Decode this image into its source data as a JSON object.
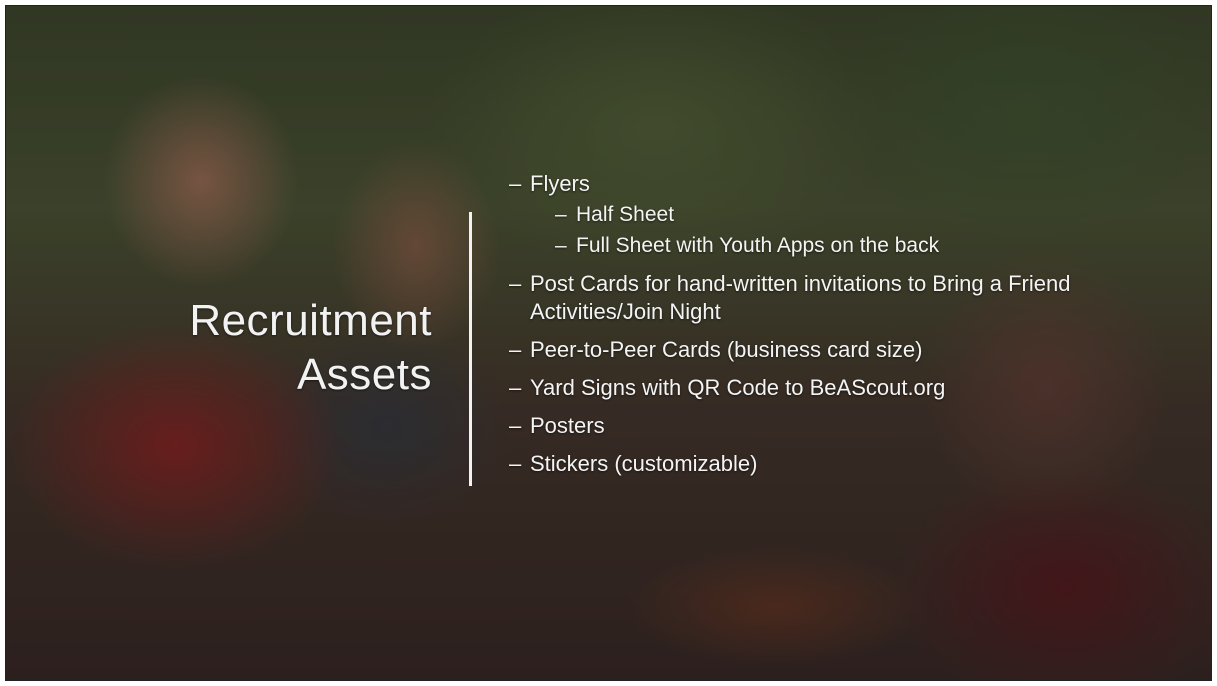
{
  "slide": {
    "title_line1": "Recruitment",
    "title_line2": "Assets",
    "items": [
      {
        "text": "Flyers",
        "level": 1
      },
      {
        "text": "Half Sheet",
        "level": 2
      },
      {
        "text": "Full Sheet with Youth Apps on the back",
        "level": 2
      },
      {
        "text": "Post Cards for hand-written invitations to Bring a Friend Activities/Join Night",
        "level": 1
      },
      {
        "text": "Peer-to-Peer Cards (business card size)",
        "level": 1
      },
      {
        "text": "Yard Signs with QR Code to BeAScout.org",
        "level": 1
      },
      {
        "text": "Posters",
        "level": 1
      },
      {
        "text": "Stickers (customizable)",
        "level": 1
      }
    ]
  }
}
